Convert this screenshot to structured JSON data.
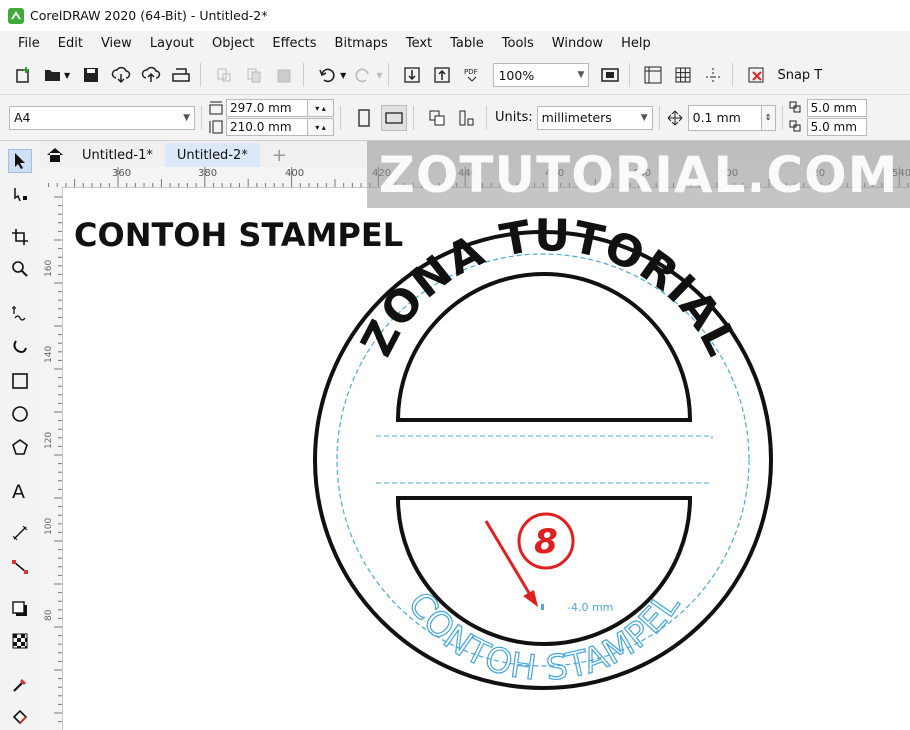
{
  "window": {
    "title": "CorelDRAW 2020 (64-Bit) - Untitled-2*"
  },
  "menu": [
    "File",
    "Edit",
    "View",
    "Layout",
    "Object",
    "Effects",
    "Bitmaps",
    "Text",
    "Table",
    "Tools",
    "Window",
    "Help"
  ],
  "toolbar": {
    "zoom": "100%",
    "snap_label": "Snap T"
  },
  "propbar": {
    "page_size": "A4",
    "width": "297.0 mm",
    "height": "210.0 mm",
    "units_label": "Units:",
    "units_value": "millimeters",
    "nudge": "0.1 mm",
    "dup_x": "5.0 mm",
    "dup_y": "5.0 mm"
  },
  "tabs": [
    {
      "label": "Untitled-1*",
      "active": false
    },
    {
      "label": "Untitled-2*",
      "active": true
    }
  ],
  "ruler_h": [
    "360",
    "380",
    "400",
    "420",
    "440",
    "460",
    "480",
    "500",
    "520",
    "540"
  ],
  "ruler_v": [
    "160",
    "140",
    "120",
    "100",
    "80"
  ],
  "canvas": {
    "heading": "CONTOH STAMPEL",
    "arc_top_text": "ZONA TUTORIAL",
    "arc_bottom_text": "CONTOH STAMPEL",
    "offset_label": "-4.0 mm",
    "step_number": "8"
  },
  "watermark": "ZOTUTORIAL.COM",
  "colors": {
    "accent": "#1e90d8",
    "annotation": "#e02020",
    "selection_blue": "#45a6dc"
  }
}
